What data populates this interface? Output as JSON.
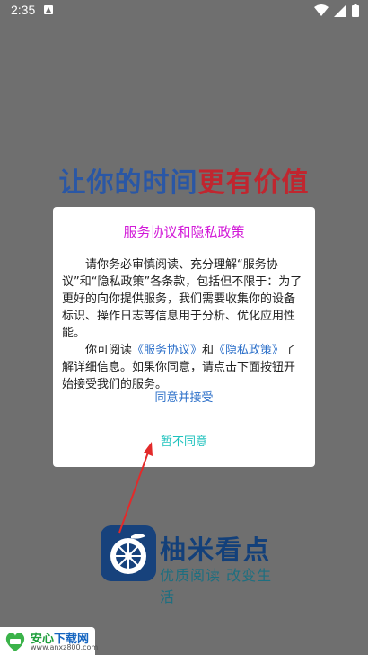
{
  "status_bar": {
    "time": "2:35"
  },
  "splash": {
    "slogan_part1": "让你的时间",
    "slogan_part2": "更有价值",
    "brand_name": "柚米看点",
    "brand_tagline": "优质阅读 改变生活"
  },
  "dialog": {
    "title": "服务协议和隐私政策",
    "para1": "请你务必审慎阅读、充分理解“服务协议”和“隐私政策”各条款，包括但不限于：为了更好的向你提供服务，我们需要收集你的设备标识、操作日志等信息用于分析、优化应用性能。",
    "para2_prefix": "你可阅读",
    "link_service": "《服务协议》",
    "para2_and": "和",
    "link_privacy": "《隐私政策》",
    "para2_suffix": "了解详细信息。如果你同意，请点击下面按钮开始接受我们的服务。",
    "agree_label": "同意并接受",
    "disagree_label": "暂不同意"
  },
  "watermark": {
    "name_part1": "安心",
    "name_part2": "下载网",
    "url": "www.anxz800.com"
  },
  "colors": {
    "overlay": "#6f6f6f",
    "title": "#d21ad8",
    "link": "#2b6fc9",
    "disagree": "#1ec2bd",
    "slogan_blue": "#2a57a5",
    "slogan_red": "#c0262f"
  }
}
